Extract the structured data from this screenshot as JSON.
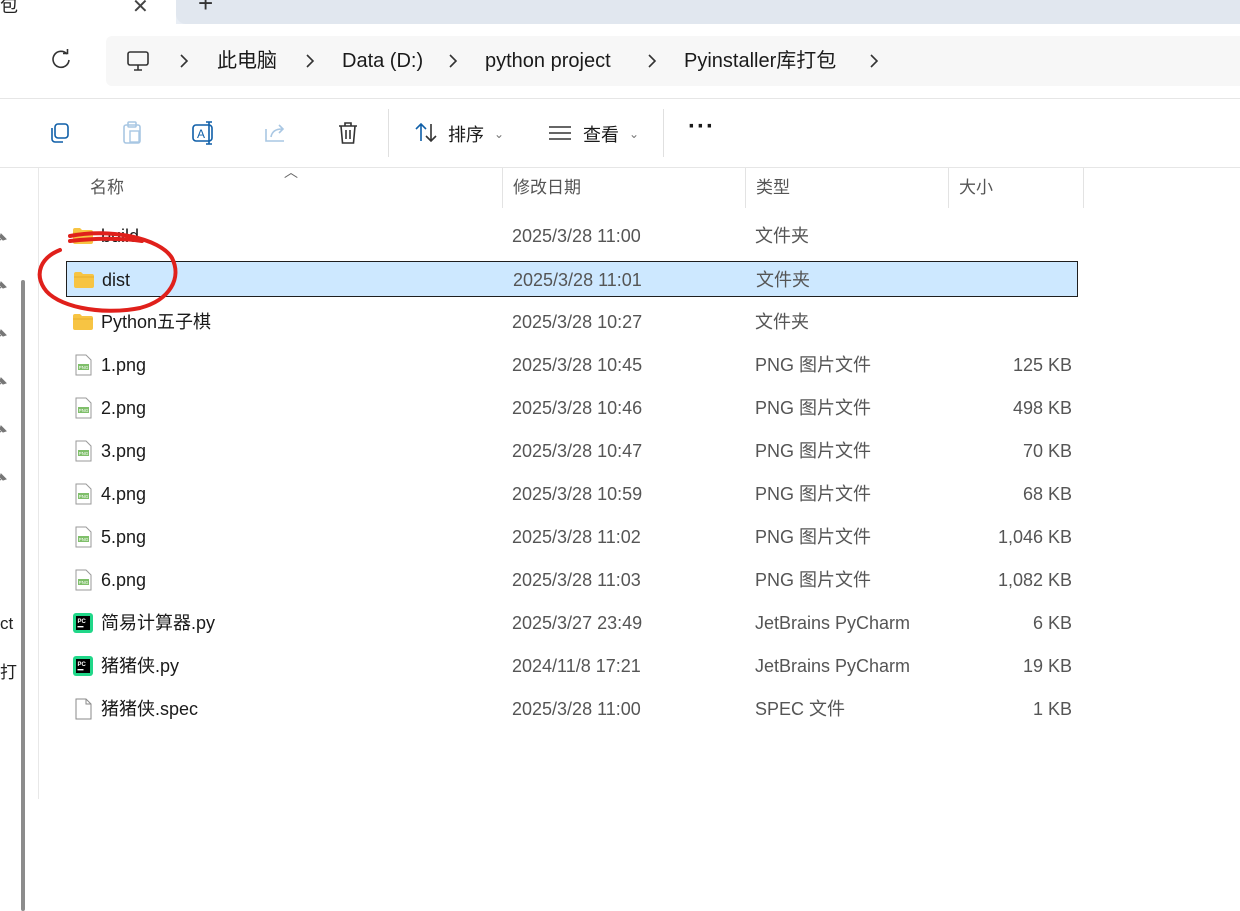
{
  "tabs": {
    "active_fragment": "包",
    "close_glyph": "✕",
    "new_glyph": "+"
  },
  "breadcrumb": [
    "此电脑",
    "Data (D:)",
    "python project",
    "Pyinstaller库打包"
  ],
  "toolbar": {
    "sort_label": "排序",
    "view_label": "查看",
    "more_label": "···"
  },
  "columns": {
    "name": "名称",
    "date": "修改日期",
    "type": "类型",
    "size": "大小"
  },
  "nav_fragments": [
    "ct",
    "打"
  ],
  "files": [
    {
      "name": "build",
      "date": "2025/3/28 11:00",
      "type": "文件夹",
      "size": "",
      "icon": "folder"
    },
    {
      "name": "dist",
      "date": "2025/3/28 11:01",
      "type": "文件夹",
      "size": "",
      "icon": "folder",
      "selected": true
    },
    {
      "name": "Python五子棋",
      "date": "2025/3/28 10:27",
      "type": "文件夹",
      "size": "",
      "icon": "folder"
    },
    {
      "name": "1.png",
      "date": "2025/3/28 10:45",
      "type": "PNG 图片文件",
      "size": "125 KB",
      "icon": "png"
    },
    {
      "name": "2.png",
      "date": "2025/3/28 10:46",
      "type": "PNG 图片文件",
      "size": "498 KB",
      "icon": "png"
    },
    {
      "name": "3.png",
      "date": "2025/3/28 10:47",
      "type": "PNG 图片文件",
      "size": "70 KB",
      "icon": "png"
    },
    {
      "name": "4.png",
      "date": "2025/3/28 10:59",
      "type": "PNG 图片文件",
      "size": "68 KB",
      "icon": "png"
    },
    {
      "name": "5.png",
      "date": "2025/3/28 11:02",
      "type": "PNG 图片文件",
      "size": "1,046 KB",
      "icon": "png"
    },
    {
      "name": "6.png",
      "date": "2025/3/28 11:03",
      "type": "PNG 图片文件",
      "size": "1,082 KB",
      "icon": "png"
    },
    {
      "name": "简易计算器.py",
      "date": "2025/3/27 23:49",
      "type": "JetBrains PyCharm",
      "size": "6 KB",
      "icon": "pycharm"
    },
    {
      "name": "猪猪侠.py",
      "date": "2024/11/8 17:21",
      "type": "JetBrains PyCharm",
      "size": "19 KB",
      "icon": "pycharm"
    },
    {
      "name": "猪猪侠.spec",
      "date": "2025/3/28 11:00",
      "type": "SPEC 文件",
      "size": "1 KB",
      "icon": "file"
    }
  ],
  "colors": {
    "selection": "#cde8ff",
    "folder": "#f7c443",
    "annotation": "#e0201b"
  }
}
